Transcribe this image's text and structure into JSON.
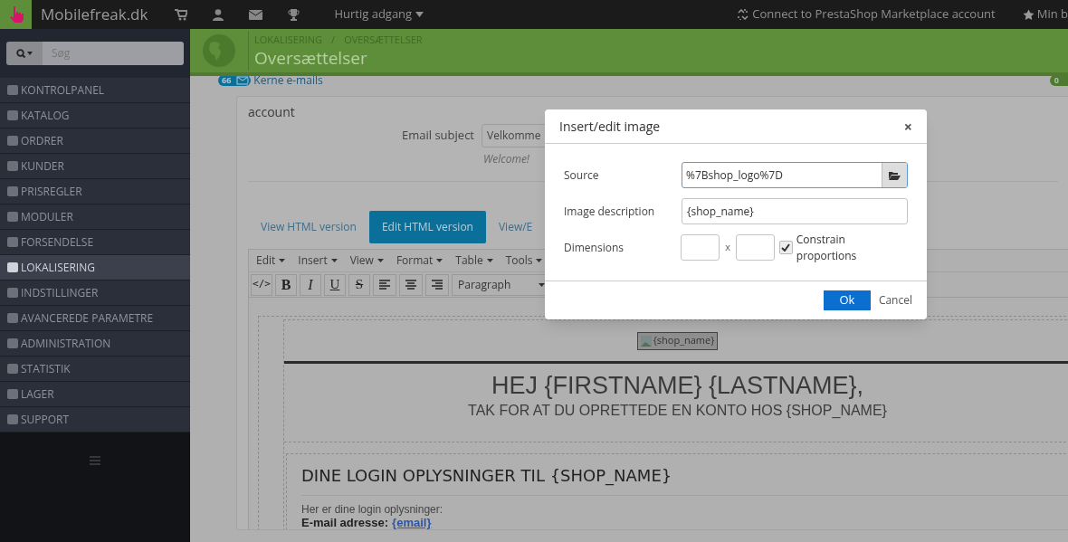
{
  "topbar": {
    "brand": "Mobilefreak.dk",
    "quick_access": "Hurtig adgang",
    "connect": "Connect to PrestaShop Marketplace account",
    "favorites": "Min b"
  },
  "sidebar": {
    "search_placeholder": "Søg",
    "items": [
      {
        "label": "KONTROLPANEL",
        "selected": false
      },
      {
        "label": "KATALOG",
        "selected": false
      },
      {
        "label": "ORDRER",
        "selected": false
      },
      {
        "label": "KUNDER",
        "selected": false
      },
      {
        "label": "PRISREGLER",
        "selected": false
      },
      {
        "label": "MODULER",
        "selected": false
      },
      {
        "label": "FORSENDELSE",
        "selected": false
      },
      {
        "label": "LOKALISERING",
        "selected": true
      },
      {
        "label": "INDSTILLINGER",
        "selected": false
      },
      {
        "label": "AVANCEREDE PARAMETRE",
        "selected": false
      },
      {
        "label": "ADMINISTRATION",
        "selected": false
      },
      {
        "label": "STATISTIK",
        "selected": false
      },
      {
        "label": "LAGER",
        "selected": false
      },
      {
        "label": "SUPPORT",
        "selected": false
      }
    ]
  },
  "header": {
    "breadcrumb": [
      "LOKALISERING",
      "OVERSÆTTELSER"
    ],
    "separator": "/",
    "title": "Oversættelser"
  },
  "section_link": {
    "count": "66",
    "label": "Kerne e-mails",
    "right_count": "0"
  },
  "panel": {
    "heading": "account",
    "subject_label": "Email subject",
    "subject_value": "Velkomme",
    "subject_hint": "Welcome!",
    "tabs": [
      {
        "label": "View HTML version",
        "selected": false
      },
      {
        "label": "Edit HTML version",
        "selected": true
      },
      {
        "label": "View/E",
        "selected": false
      }
    ],
    "menubar": [
      "Edit",
      "Insert",
      "View",
      "Format",
      "Table",
      "Tools"
    ],
    "toolbar": [
      {
        "kind": "code",
        "label": "</>"
      },
      {
        "kind": "bold",
        "label": "B"
      },
      {
        "kind": "italic",
        "label": "I"
      },
      {
        "kind": "underline",
        "label": "U"
      },
      {
        "kind": "strike",
        "label": "S"
      },
      {
        "kind": "align-left"
      },
      {
        "kind": "align-center"
      },
      {
        "kind": "align-right"
      },
      {
        "kind": "select",
        "label": "Paragraph"
      }
    ],
    "email": {
      "image_alt": "{shop_name}",
      "greeting": "HEJ {FIRSTNAME} {LASTNAME},",
      "thanks": "TAK FOR AT DU OPRETTEDE EN KONTO HOS {SHOP_NAME}",
      "login_heading": "DINE LOGIN OPLYSNINGER TIL {SHOP_NAME}",
      "login_intro": "Her er dine login oplysninger:",
      "email_label": "E-mail adresse:",
      "email_link": "{email}"
    }
  },
  "dialog": {
    "title": "Insert/edit image",
    "close": "×",
    "source_label": "Source",
    "source_value": "%7Bshop_logo%7D",
    "description_label": "Image description",
    "description_value": "{shop_name}",
    "dimensions_label": "Dimensions",
    "times": "x",
    "constrain_label": "Constrain proportions",
    "constrain_checked": true,
    "ok": "Ok",
    "cancel": "Cancel"
  }
}
